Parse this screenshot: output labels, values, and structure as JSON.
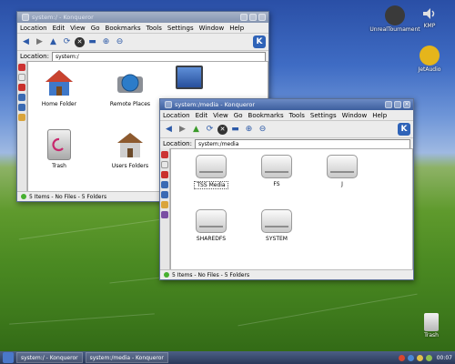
{
  "desktop": {
    "icons": [
      {
        "label": "UnrealTournament",
        "icon": "unreal-tournament-icon",
        "color": "#3a3a3a"
      },
      {
        "label": "KMP",
        "icon": "speaker-icon",
        "color": "#d8d8d8"
      },
      {
        "label": "JetAudio",
        "icon": "music-note-icon",
        "color": "#e5b51b"
      },
      {
        "label": "Trash",
        "icon": "trash-icon",
        "color": "#cfcfcf"
      }
    ]
  },
  "window_back": {
    "title": "system:/ - Konqueror",
    "menu": [
      "Location",
      "Edit",
      "View",
      "Go",
      "Bookmarks",
      "Tools",
      "Settings",
      "Window",
      "Help"
    ],
    "location_label": "Location:",
    "location_value": "system:/",
    "items": [
      {
        "label": "Home Folder",
        "icon": "home-folder-icon"
      },
      {
        "label": "Remote Places",
        "icon": "remote-places-icon"
      },
      {
        "label": "Trash",
        "icon": "trash-icon"
      },
      {
        "label": "Users Folders",
        "icon": "users-folder-icon"
      }
    ],
    "status": "5 Items - No Files - 5 Folders"
  },
  "window_front": {
    "title": "system:/media - Konqueror",
    "menu": [
      "Location",
      "Edit",
      "View",
      "Go",
      "Bookmarks",
      "Tools",
      "Settings",
      "Window",
      "Help"
    ],
    "location_label": "Location:",
    "location_value": "system:/media",
    "items": [
      {
        "label": "TSS Media"
      },
      {
        "label": "FS"
      },
      {
        "label": "J"
      },
      {
        "label": "SHAREDFS"
      },
      {
        "label": "SYSTEM"
      }
    ],
    "status": "5 Items - No Files - 5 Folders"
  },
  "taskbar": {
    "tasks": [
      "system:/ - Konqueror",
      "system:/media - Konqueror"
    ],
    "clock": "00:07"
  },
  "colors": {
    "accent": "#3d5f9e",
    "kde_blue": "#2f63b8",
    "status_led": "#46b030"
  }
}
